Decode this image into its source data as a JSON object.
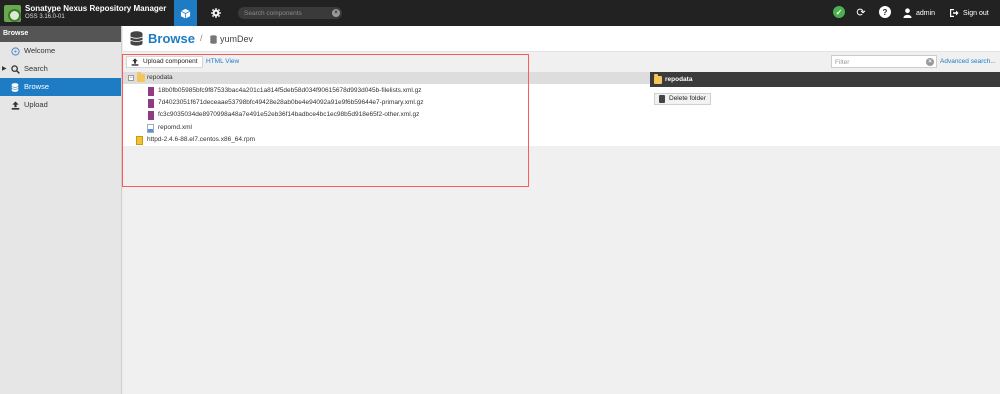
{
  "app": {
    "title": "Sonatype Nexus Repository Manager",
    "version": "OSS 3.16.0-01"
  },
  "header": {
    "search_placeholder": "Search components",
    "user": "admin",
    "signout_label": "Sign out"
  },
  "sidebar": {
    "header": "Browse",
    "items": [
      {
        "label": "Welcome",
        "icon": "compass-icon",
        "active": false
      },
      {
        "label": "Search",
        "icon": "search-icon",
        "active": false
      },
      {
        "label": "Browse",
        "icon": "database-icon",
        "active": true
      },
      {
        "label": "Upload",
        "icon": "upload-icon",
        "active": false
      }
    ]
  },
  "breadcrumb": {
    "title": "Browse",
    "separator": "/",
    "repository": "yumDev"
  },
  "toolbar": {
    "upload_label": "Upload component",
    "html_view_label": "HTML View",
    "filter_placeholder": "Filter",
    "advanced_search_label": "Advanced search..."
  },
  "tree": {
    "items": [
      {
        "name": "repodata",
        "type": "folder",
        "expanded": true,
        "selected": true
      },
      {
        "name": "18b0fb05985bfc9f87533bac4a201c1a814f5deb58d034f90615678d993d045b-filelists.xml.gz",
        "type": "gz"
      },
      {
        "name": "7d4023051f671deceaae53798bfc49428e28ab0be4e94092a91e9f6b59644e7-primary.xml.gz",
        "type": "gz"
      },
      {
        "name": "fc3c9035034de8970998a48a7e491e52eb36f14badbce4bc1ec98b5d918e65f2-other.xml.gz",
        "type": "gz"
      },
      {
        "name": "repomd.xml",
        "type": "xml"
      },
      {
        "name": "httpd-2.4.6-88.el7.centos.x86_64.rpm",
        "type": "rpm"
      }
    ]
  },
  "detail": {
    "title": "repodata",
    "delete_label": "Delete folder"
  },
  "colors": {
    "accent": "#1d7cc4",
    "header_bg": "#222222",
    "highlight": "#ff5a5a"
  }
}
